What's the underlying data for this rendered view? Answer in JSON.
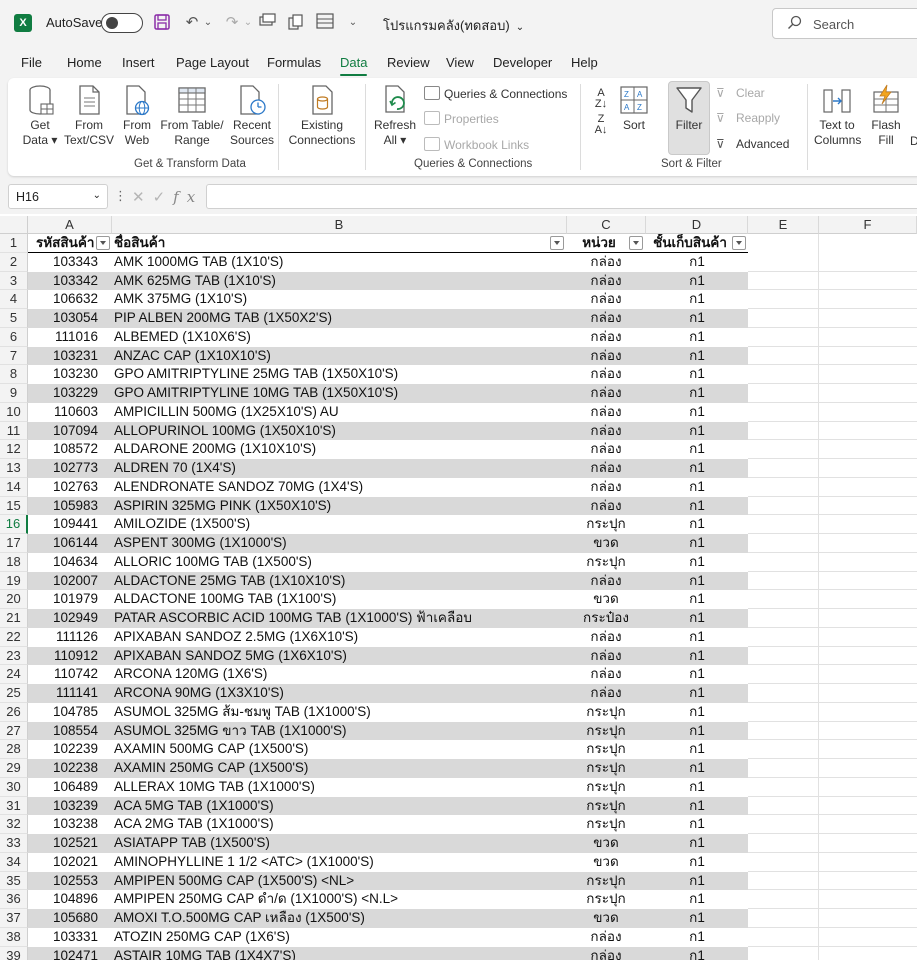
{
  "titlebar": {
    "autosave_label": "AutoSave",
    "doc_title": "โปรแกรมคลัง(ทดสอบ)",
    "search_placeholder": "Search"
  },
  "menu": {
    "tabs": [
      "File",
      "Home",
      "Insert",
      "Page Layout",
      "Formulas",
      "Data",
      "Review",
      "View",
      "Developer",
      "Help"
    ],
    "active": "Data"
  },
  "ribbon": {
    "get_data": [
      "Get",
      "Data ▾"
    ],
    "from_text": [
      "From",
      "Text/CSV"
    ],
    "from_web": [
      "From",
      "Web"
    ],
    "from_table": [
      "From Table/",
      "Range"
    ],
    "recent_sources": [
      "Recent",
      "Sources"
    ],
    "existing_connections": [
      "Existing",
      "Connections"
    ],
    "group_get_transform": "Get & Transform Data",
    "refresh_all": [
      "Refresh",
      "All ▾"
    ],
    "queries_connections": "Queries & Connections",
    "properties": "Properties",
    "workbook_links": "Workbook Links",
    "group_queries": "Queries & Connections",
    "sort": "Sort",
    "filter": "Filter",
    "clear": "Clear",
    "reapply": "Reapply",
    "advanced": "Advanced",
    "group_sort_filter": "Sort & Filter",
    "text_to_columns": [
      "Text to",
      "Columns"
    ],
    "flash_fill": [
      "Flash",
      "Fill"
    ],
    "cut_letter": "D"
  },
  "formula_bar": {
    "name_box": "H16",
    "formula": ""
  },
  "grid": {
    "columns": [
      "A",
      "B",
      "C",
      "D",
      "E",
      "F"
    ],
    "active_row": 16,
    "headers": [
      "รหัสสินค้า",
      "ชื่อสินค้า",
      "หน่วย",
      "ชั้นเก็บสินค้า"
    ],
    "rows": [
      [
        "103343",
        "AMK 1000MG TAB (1X10'S)",
        "กล่อง",
        "ก1"
      ],
      [
        "103342",
        "AMK 625MG TAB (1X10'S)",
        "กล่อง",
        "ก1"
      ],
      [
        "106632",
        "AMK 375MG (1X10'S)",
        "กล่อง",
        "ก1"
      ],
      [
        "103054",
        "PIP ALBEN 200MG TAB (1X50X2'S)",
        "กล่อง",
        "ก1"
      ],
      [
        "111016",
        "ALBEMED (1X10X6'S)",
        "กล่อง",
        "ก1"
      ],
      [
        "103231",
        "ANZAC CAP (1X10X10'S)",
        "กล่อง",
        "ก1"
      ],
      [
        "103230",
        "GPO AMITRIPTYLINE 25MG TAB (1X50X10'S)",
        "กล่อง",
        "ก1"
      ],
      [
        "103229",
        "GPO AMITRIPTYLINE 10MG TAB (1X50X10'S)",
        "กล่อง",
        "ก1"
      ],
      [
        "110603",
        "AMPICILLIN 500MG (1X25X10'S) AU",
        "กล่อง",
        "ก1"
      ],
      [
        "107094",
        "ALLOPURINOL 100MG (1X50X10'S)",
        "กล่อง",
        "ก1"
      ],
      [
        "108572",
        "ALDARONE 200MG (1X10X10'S)",
        "กล่อง",
        "ก1"
      ],
      [
        "102773",
        "ALDREN 70 (1X4'S)",
        "กล่อง",
        "ก1"
      ],
      [
        "102763",
        "ALENDRONATE SANDOZ 70MG (1X4'S)",
        "กล่อง",
        "ก1"
      ],
      [
        "105983",
        "ASPIRIN 325MG PINK (1X50X10'S)",
        "กล่อง",
        "ก1"
      ],
      [
        "109441",
        "AMILOZIDE (1X500'S)",
        "กระปุก",
        "ก1"
      ],
      [
        "106144",
        "ASPENT 300MG (1X1000'S)",
        "ขวด",
        "ก1"
      ],
      [
        "104634",
        "ALLORIC 100MG TAB (1X500'S)",
        "กระปุก",
        "ก1"
      ],
      [
        "102007",
        "ALDACTONE 25MG TAB (1X10X10'S)",
        "กล่อง",
        "ก1"
      ],
      [
        "101979",
        "ALDACTONE 100MG TAB (1X100'S)",
        "ขวด",
        "ก1"
      ],
      [
        "102949",
        "PATAR ASCORBIC ACID 100MG TAB (1X1000'S) ฟ้าเคลือบ",
        "กระป๋อง",
        "ก1"
      ],
      [
        "111126",
        "APIXABAN SANDOZ 2.5MG (1X6X10'S)",
        "กล่อง",
        "ก1"
      ],
      [
        "110912",
        "APIXABAN SANDOZ 5MG (1X6X10'S)",
        "กล่อง",
        "ก1"
      ],
      [
        "110742",
        "ARCONA 120MG (1X6'S)",
        "กล่อง",
        "ก1"
      ],
      [
        "111141",
        "ARCONA 90MG (1X3X10'S)",
        "กล่อง",
        "ก1"
      ],
      [
        "104785",
        "ASUMOL 325MG ส้ม-ชมพู TAB (1X1000'S)",
        "กระปุก",
        "ก1"
      ],
      [
        "108554",
        "ASUMOL 325MG ขาว TAB (1X1000'S)",
        "กระปุก",
        "ก1"
      ],
      [
        "102239",
        "AXAMIN 500MG CAP (1X500'S)",
        "กระปุก",
        "ก1"
      ],
      [
        "102238",
        "AXAMIN 250MG CAP (1X500'S)",
        "กระปุก",
        "ก1"
      ],
      [
        "106489",
        "ALLERAX 10MG TAB (1X1000'S)",
        "กระปุก",
        "ก1"
      ],
      [
        "103239",
        "ACA 5MG TAB (1X1000'S)",
        "กระปุก",
        "ก1"
      ],
      [
        "103238",
        "ACA 2MG TAB (1X1000'S)",
        "กระปุก",
        "ก1"
      ],
      [
        "102521",
        "ASIATAPP TAB (1X500'S)",
        "ขวด",
        "ก1"
      ],
      [
        "102021",
        "AMINOPHYLLINE 1 1/2 <ATC> (1X1000'S)",
        "ขวด",
        "ก1"
      ],
      [
        "102553",
        "AMPIPEN 500MG CAP (1X500'S) <NL>",
        "กระปุก",
        "ก1"
      ],
      [
        "104896",
        "AMPIPEN 250MG CAP ดำ/ด (1X1000'S) <N.L>",
        "กระปุก",
        "ก1"
      ],
      [
        "105680",
        "AMOXI T.O.500MG CAP เหลือง (1X500'S)",
        "ขวด",
        "ก1"
      ],
      [
        "103331",
        "ATOZIN 250MG CAP (1X6'S)",
        "กล่อง",
        "ก1"
      ],
      [
        "102471",
        "ASTAIR 10MG TAB (1X4X7'S)",
        "กล่อง",
        "ก1"
      ]
    ]
  }
}
